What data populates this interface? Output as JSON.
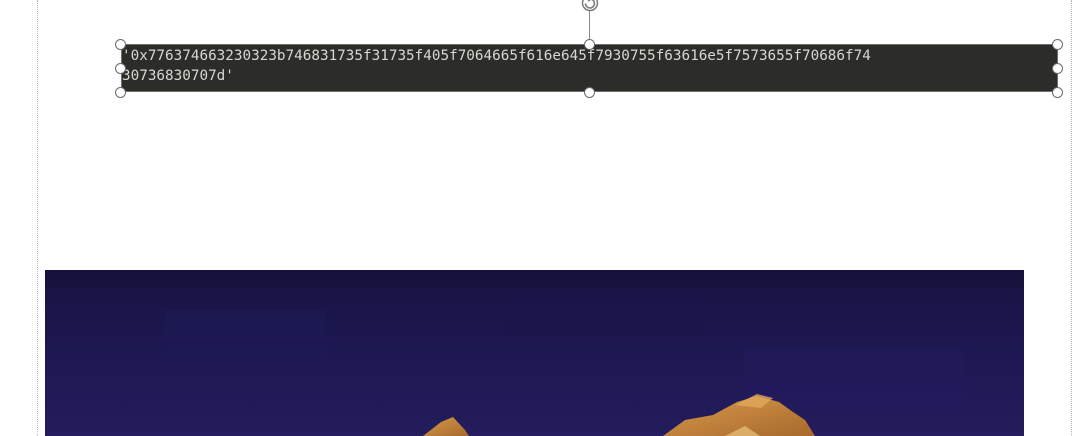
{
  "code_block": {
    "line1": "'0x776374663230323b746831735f31735f405f7064665f616e645f7930755f63616e5f7573655f70686f74",
    "line2": "30736830707d'"
  },
  "icons": {
    "rotate_handle": "rotate-icon",
    "resize_handles": "circle-handle-icon"
  },
  "colors": {
    "code_background": "#2c2d29",
    "code_text": "#d7d7d2",
    "image_sky": "#1d1852",
    "image_object": "#c9883f"
  }
}
